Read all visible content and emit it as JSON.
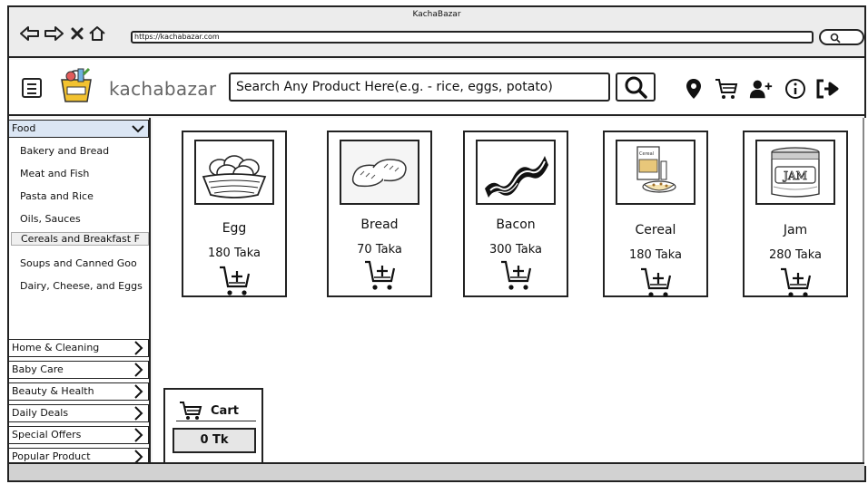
{
  "window": {
    "title": "KachaBazar",
    "url": "https://kachabazar.com"
  },
  "header": {
    "logo_text": "kachabazar",
    "search_text": "Search Any Product Here(e.g. - rice, eggs, potato)"
  },
  "sidebar": {
    "food": {
      "label": "Food",
      "items": [
        "Bakery and Bread",
        "Meat and Fish",
        "Pasta and Rice",
        "Oils, Sauces",
        "Cereals and Breakfast F",
        "Soups and Canned Goo",
        "Dairy, Cheese, and Eggs"
      ],
      "selected_index": 4
    },
    "categories": [
      "Home & Cleaning",
      "Baby Care",
      "Beauty & Health",
      "Daily Deals",
      "Special Offers",
      "Popular Product"
    ]
  },
  "products": [
    {
      "name": "Egg",
      "price": "180 Taka",
      "image": "egg-basket-image"
    },
    {
      "name": "Bread",
      "price": "70 Taka",
      "image": "bread-image"
    },
    {
      "name": "Bacon",
      "price": "300 Taka",
      "image": "bacon-image"
    },
    {
      "name": "Cereal",
      "price": "180 Taka",
      "image": "cereal-image",
      "image_text": "Cereal"
    },
    {
      "name": "Jam",
      "price": "280 Taka",
      "image": "jam-jar-image",
      "image_text": "JAM"
    }
  ],
  "cart": {
    "title": "Cart",
    "total": "0 Tk"
  },
  "colors": {
    "sidebar_active": "#dbe6f4",
    "border": "#222222"
  }
}
